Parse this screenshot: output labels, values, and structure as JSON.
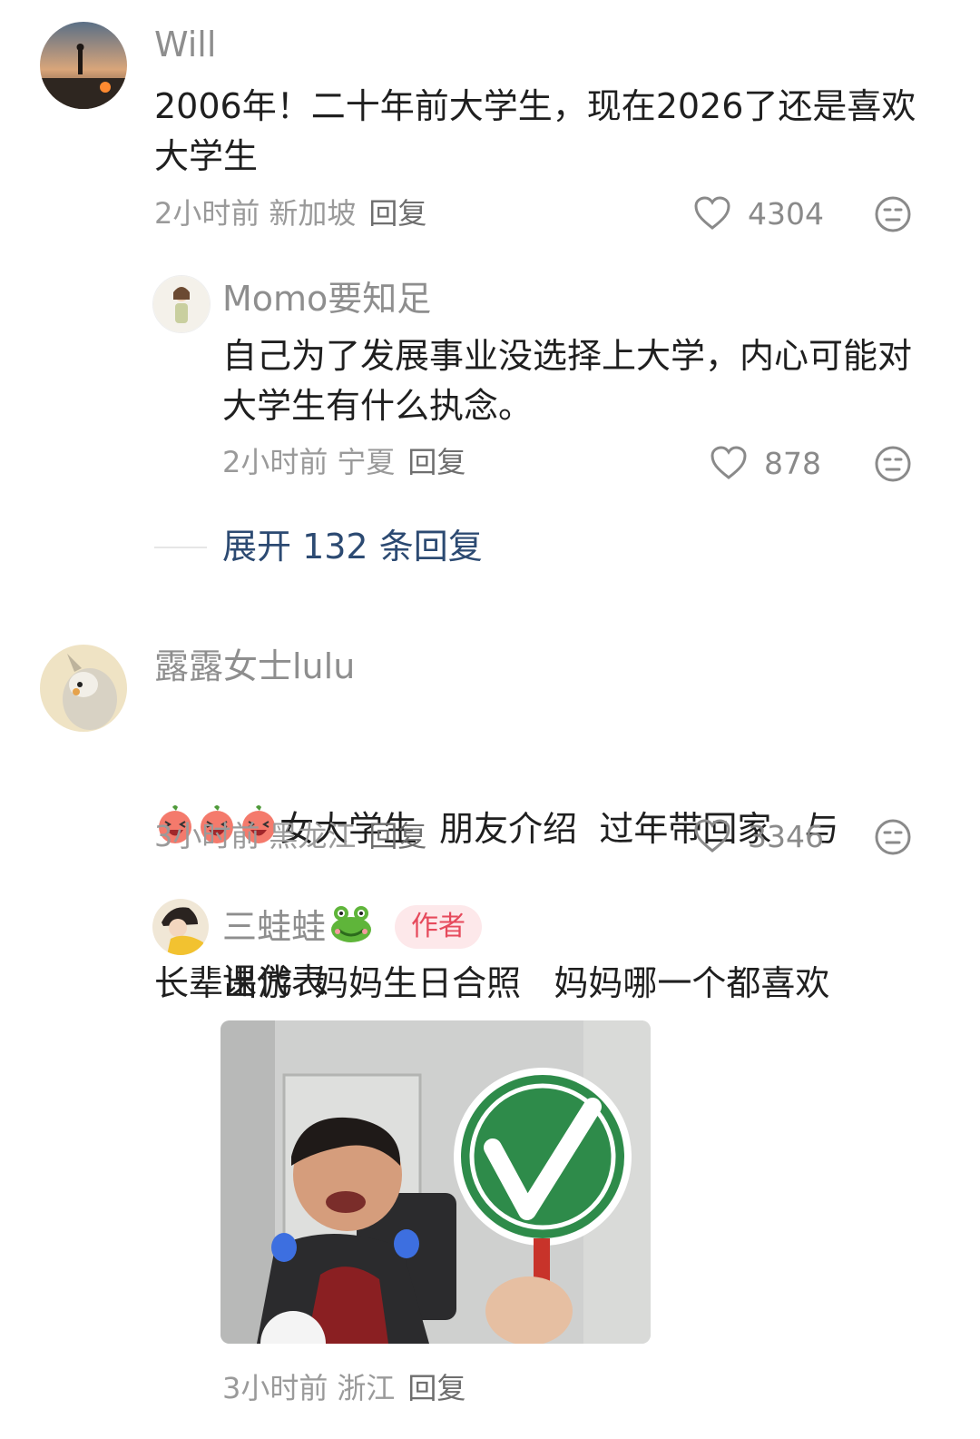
{
  "comments": [
    {
      "username": "Will",
      "text": "2006年！二十年前大学生，现在2026了还是喜欢大学生",
      "time": "2小时前",
      "location": "新加坡",
      "reply_label": "回复",
      "likes": "4304",
      "replies": [
        {
          "username": "Momo要知足",
          "text": "自己为了发展事业没选择上大学，内心可能对大学生有什么执念。",
          "time": "2小时前",
          "location": "宁夏",
          "reply_label": "回复",
          "likes": "878"
        }
      ],
      "expand_label": "展开 132 条回复"
    },
    {
      "username": "露露女士lulu",
      "text_line1": "女大学生  朋友介绍  过年带回家   与",
      "text_line2": "长辈出游  妈妈生日合照   妈妈哪一个都喜欢",
      "time": "3小时前",
      "location": "黑龙江",
      "reply_label": "回复",
      "likes": "3346",
      "replies": [
        {
          "username": "三蛙蛙",
          "badge": "作者",
          "text": "课代表",
          "time": "3小时前",
          "location": "浙江",
          "reply_label": "回复"
        }
      ]
    }
  ],
  "icons": {
    "like": "heart-outline-icon",
    "dislike": "neutral-face-icon",
    "emoji": "laughing-peach-emoji",
    "frog": "frog-emoji"
  },
  "colors": {
    "accent_link": "#2c4a72",
    "author_badge_bg": "#fde8ea",
    "author_badge_text": "#e64a5c"
  }
}
